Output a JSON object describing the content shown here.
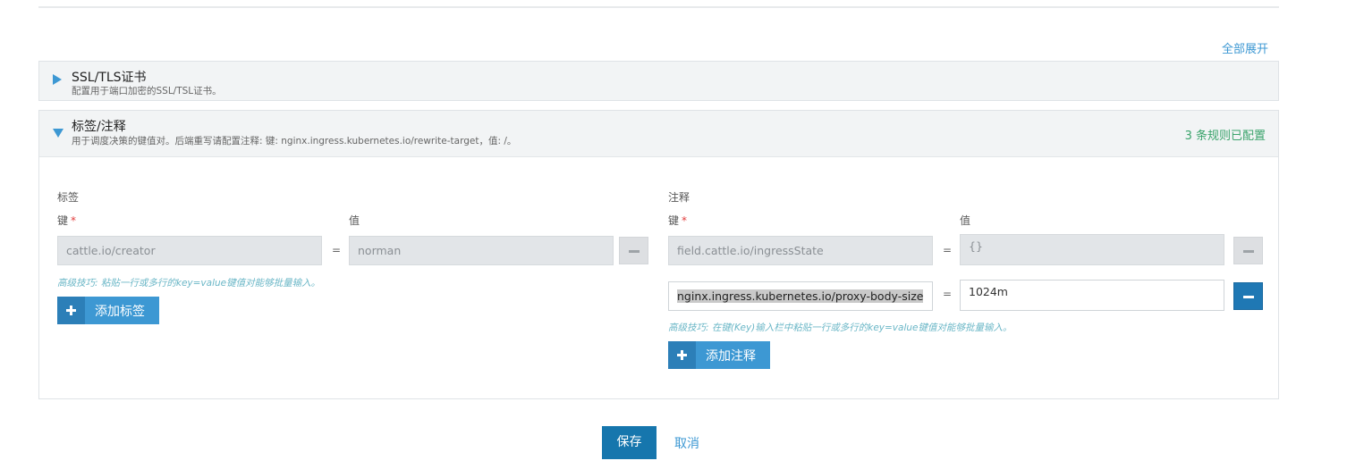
{
  "expand_all": "全部展开",
  "ssl_section": {
    "title": "SSL/TLS证书",
    "description": "配置用于端口加密的SSL/TSL证书。"
  },
  "labels_section": {
    "title": "标签/注释",
    "description": "用于调度决策的键值对。后端重写请配置注释: 键: nginx.ingress.kubernetes.io/rewrite-target，值: /。",
    "status": "3 条规则已配置",
    "labels": {
      "heading": "标签",
      "key_label": "键",
      "required_mark": "*",
      "value_label": "值",
      "rows": [
        {
          "key": "cattle.io/creator",
          "eq": "=",
          "value": "norman"
        }
      ],
      "tip": "高级技巧: 粘贴一行或多行的key=value键值对能够批量输入。",
      "add_button": "添加标签"
    },
    "annotations": {
      "heading": "注释",
      "key_label": "键",
      "required_mark": "*",
      "value_label": "值",
      "rows": [
        {
          "key": "field.cattle.io/ingressState",
          "eq": "=",
          "value": "{}"
        },
        {
          "key": "nginx.ingress.kubernetes.io/proxy-body-size",
          "eq": "=",
          "value": "1024m"
        }
      ],
      "tip": "高级技巧: 在键(Key)输入栏中粘贴一行或多行的key=value键值对能够批量输入。",
      "add_button": "添加注释"
    }
  },
  "footer": {
    "save": "保存",
    "cancel": "取消"
  },
  "colors": {
    "accent": "#3d98d3",
    "primary_button": "#1676ad",
    "status_green": "#3aa36b",
    "required_red": "#e23d3d",
    "tip_text": "#6bb7c7"
  }
}
